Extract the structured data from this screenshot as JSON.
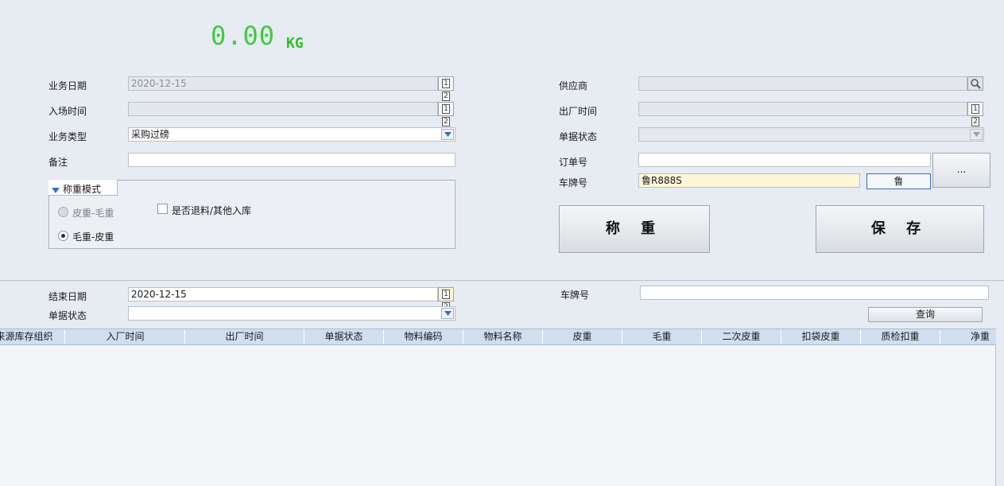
{
  "scale": {
    "value": "0.00",
    "unit": "KG"
  },
  "form_left": {
    "business_date": {
      "label": "业务日期",
      "value": "2020-12-15"
    },
    "entry_time": {
      "label": "入场时间",
      "value": ""
    },
    "business_type": {
      "label": "业务类型",
      "value": "采购过磅"
    },
    "remark": {
      "label": "备注",
      "value": ""
    }
  },
  "weigh_mode": {
    "title": "称重模式",
    "options": [
      {
        "label": "皮重-毛重",
        "selected": false,
        "enabled": false
      },
      {
        "label": "毛重-皮重",
        "selected": true,
        "enabled": true
      }
    ],
    "return_checkbox": {
      "label": "是否退料/其他入库",
      "checked": false
    }
  },
  "form_right": {
    "supplier": {
      "label": "供应商",
      "value": ""
    },
    "exit_time": {
      "label": "出厂时间",
      "value": ""
    },
    "doc_status": {
      "label": "单据状态",
      "value": ""
    },
    "order_no": {
      "label": "订单号",
      "value": ""
    },
    "plate_no": {
      "label": "车牌号",
      "value": "鲁R888S",
      "province_button": "鲁"
    },
    "ellipsis_button": "..."
  },
  "actions": {
    "weigh": "称 重",
    "save": "保 存"
  },
  "filters": {
    "end_date": {
      "label": "结束日期",
      "value": "2020-12-15"
    },
    "doc_status": {
      "label": "单据状态",
      "value": ""
    },
    "plate_no": {
      "label": "车牌号",
      "value": ""
    },
    "query_button": "查询"
  },
  "table": {
    "columns": [
      "来源库存组织",
      "入厂时间",
      "出厂时间",
      "单据状态",
      "物料编码",
      "物料名称",
      "皮重",
      "毛重",
      "二次皮重",
      "扣袋皮重",
      "质检扣重",
      "净重"
    ],
    "rows": []
  },
  "colors": {
    "weight_display": "#3dcc3d",
    "grid_header": "#cfdff0",
    "background": "#e7ebf2"
  }
}
